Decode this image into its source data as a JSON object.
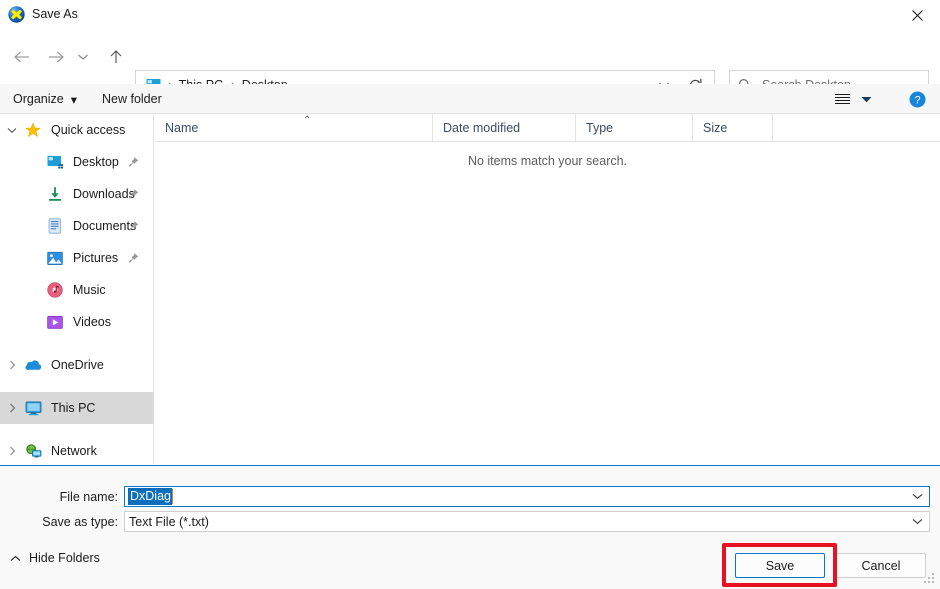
{
  "window": {
    "title": "Save As",
    "icon": "dxdiag-icon",
    "close_label": "×"
  },
  "nav": {
    "back_icon": "arrow-left-icon",
    "forward_icon": "arrow-right-icon",
    "recent_icon": "chevron-down-icon",
    "up_icon": "arrow-up-icon",
    "refresh_icon": "refresh-icon",
    "address_chevron_icon": "chevron-down-icon",
    "breadcrumbs": [
      {
        "label": "This PC"
      },
      {
        "label": "Desktop"
      }
    ],
    "separator": "›",
    "breadcrumb_icon": "desktop-icon"
  },
  "search": {
    "placeholder": "Search Desktop",
    "icon": "search-icon"
  },
  "toolbar": {
    "organize_label": "Organize",
    "organize_caret": "▾",
    "new_folder_label": "New folder",
    "view_icon": "list-view-icon",
    "view_caret_icon": "chevron-down-icon",
    "help_icon": "help-icon",
    "help_glyph": "?"
  },
  "sidebar": {
    "groups": [
      {
        "label": "Quick access",
        "icon": "star-icon",
        "expander": "chevron-expanded",
        "selected": false,
        "children": [
          {
            "label": "Desktop",
            "icon": "desktop-icon",
            "pinned": true
          },
          {
            "label": "Downloads",
            "icon": "download-icon",
            "pinned": true
          },
          {
            "label": "Documents",
            "icon": "documents-icon",
            "pinned": true
          },
          {
            "label": "Pictures",
            "icon": "pictures-icon",
            "pinned": true
          },
          {
            "label": "Music",
            "icon": "music-icon",
            "pinned": false
          },
          {
            "label": "Videos",
            "icon": "videos-icon",
            "pinned": false
          }
        ]
      },
      {
        "label": "OneDrive",
        "icon": "onedrive-cloud-icon",
        "expander": "chevron-collapsed",
        "selected": false,
        "children": []
      },
      {
        "label": "This PC",
        "icon": "this-pc-icon",
        "expander": "chevron-collapsed",
        "selected": true,
        "children": []
      },
      {
        "label": "Network",
        "icon": "network-icon",
        "expander": "chevron-collapsed",
        "selected": false,
        "children": []
      }
    ],
    "pin_icon": "pin-icon"
  },
  "filelist": {
    "columns": [
      {
        "label": "Name",
        "sorted": true,
        "sort_caret": "⌃"
      },
      {
        "label": "Date modified",
        "sorted": false,
        "sort_caret": ""
      },
      {
        "label": "Type",
        "sorted": false,
        "sort_caret": ""
      },
      {
        "label": "Size",
        "sorted": false,
        "sort_caret": ""
      }
    ],
    "empty_message": "No items match your search.",
    "rows": []
  },
  "form": {
    "filename_label": "File name:",
    "filename_value": "DxDiag",
    "filename_selected": true,
    "savetype_label": "Save as type:",
    "savetype_value": "Text File (*.txt)",
    "savetype_options": [
      "Text File (*.txt)"
    ],
    "combo_chevron": "⌄"
  },
  "footer": {
    "hide_folders_label": "Hide Folders",
    "hide_folders_icon": "chevron-up-icon",
    "save_label": "Save",
    "cancel_label": "Cancel",
    "resize_grip_icon": "resize-grip-icon"
  },
  "colors": {
    "accent": "#0a78c8",
    "highlight_box": "#e81123",
    "selection_fill": "#0a6ebd",
    "tree_selected": "#d8d8d8",
    "toolbar_bg": "#f7f7f7",
    "bottom_bg": "#f9f9f9",
    "column_header_text": "#3c4a66"
  }
}
